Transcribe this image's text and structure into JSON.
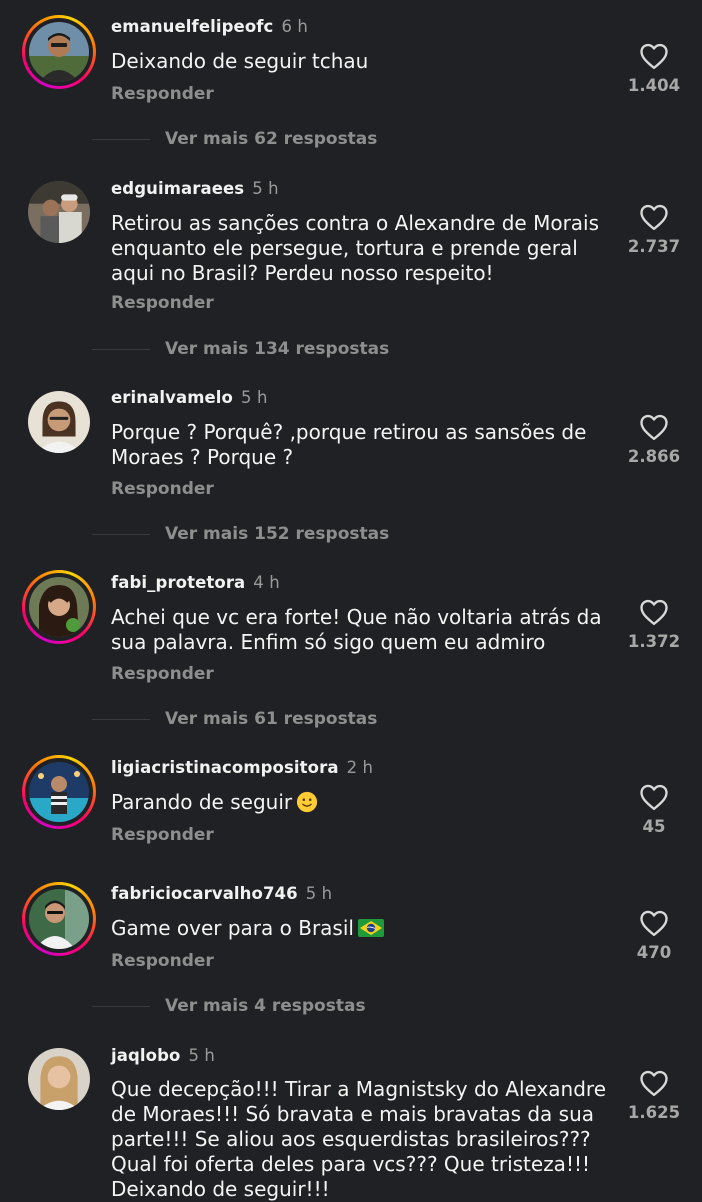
{
  "comments": [
    {
      "username": "emanuelfelipeofc",
      "time": "6 h",
      "text": "Deixando de seguir tchau",
      "reply_label": "Responder",
      "likes": "1.404",
      "more_replies": "Ver mais 62 respostas",
      "avatar_ring": true
    },
    {
      "username": "edguimaraees",
      "time": "5 h",
      "text": "Retirou as sanções contra o Alexandre de Morais enquanto ele persegue, tortura e prende geral aqui no Brasil? Perdeu nosso respeito!",
      "reply_label": "Responder",
      "likes": "2.737",
      "more_replies": "Ver mais 134 respostas",
      "avatar_ring": false
    },
    {
      "username": "erinalvamelo",
      "time": "5 h",
      "text": "Porque ? Porquê? ,porque retirou as sansões de Moraes ? Porque ?",
      "reply_label": "Responder",
      "likes": "2.866",
      "more_replies": "Ver mais 152 respostas",
      "avatar_ring": false
    },
    {
      "username": "fabi_protetora",
      "time": "4 h",
      "text": "Achei que vc era forte! Que não voltaria atrás da sua palavra. Enfim só sigo quem eu admiro",
      "reply_label": "Responder",
      "likes": "1.372",
      "more_replies": "Ver mais 61 respostas",
      "avatar_ring": true
    },
    {
      "username": "ligiacristinacompositora",
      "time": "2 h",
      "text": "Parando de seguir",
      "emoji": "slightly-smiling-face",
      "reply_label": "Responder",
      "likes": "45",
      "avatar_ring": true
    },
    {
      "username": "fabriciocarvalho746",
      "time": "5 h",
      "text": "Game over para o Brasil",
      "emoji": "brazil-flag",
      "reply_label": "Responder",
      "likes": "470",
      "more_replies": "Ver mais 4 respostas",
      "avatar_ring": true
    },
    {
      "username": "jaqlobo",
      "time": "5 h",
      "text": "Que decepção!!! Tirar a Magnistsky do Alexandre de Moraes!!! Só bravata e mais bravatas da sua parte!!! Se aliou aos esquerdistas brasileiros??? Qual foi oferta deles para vcs??? Que tristeza!!! Deixando de seguir!!!",
      "likes": "1.625",
      "avatar_ring": false
    }
  ],
  "colors": {
    "background": "#202124",
    "secondary_text": "#8e8e8e",
    "ring_gradient": [
      "#d300c5",
      "#ff0069",
      "#ff7a00",
      "#ffd600"
    ]
  },
  "icons": [
    "heart-outline-icon",
    "slightly-smiling-face-emoji",
    "brazil-flag-emoji"
  ]
}
